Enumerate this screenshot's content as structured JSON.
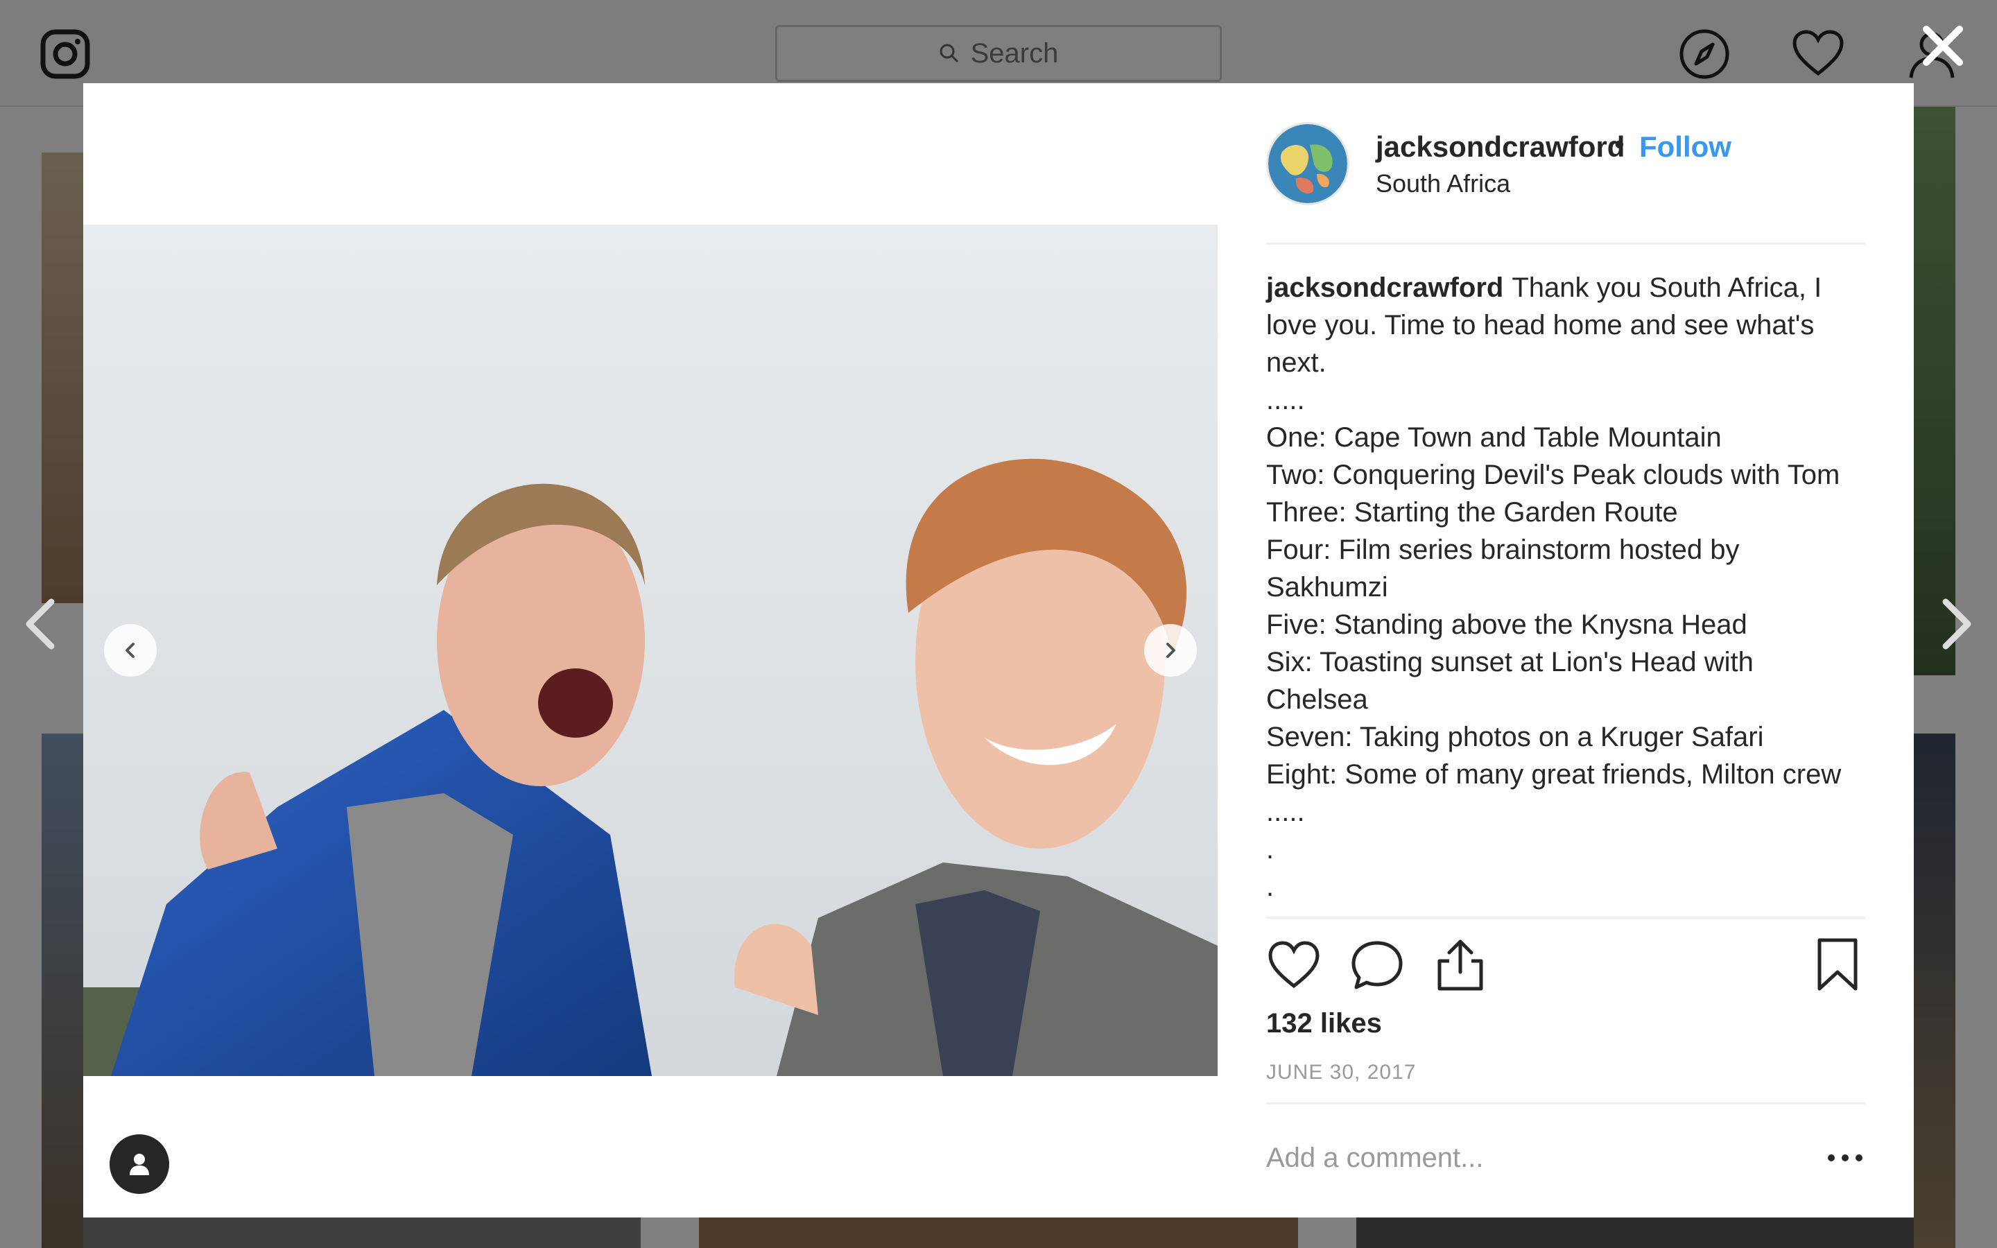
{
  "topbar": {
    "search_placeholder": "Search",
    "icons": [
      "instagram-logo-icon",
      "compass-icon",
      "heart-icon",
      "user-icon",
      "close-icon"
    ]
  },
  "post": {
    "username": "jacksondcrawford",
    "separator": "•",
    "follow_label": "Follow",
    "location": "South Africa",
    "caption_user": "jacksondcrawford",
    "caption_lines": [
      "Thank you South Africa, I",
      "love you. Time to head home and see what's",
      "next.",
      ".....",
      "One: Cape Town and Table Mountain",
      "Two: Conquering Devil's Peak clouds with Tom",
      "Three: Starting the Garden Route",
      "Four: Film series brainstorm hosted by",
      "Sakhumzi",
      "Five: Standing above the Knysna Head",
      "Six: Toasting sunset at Lion's Head with",
      "Chelsea",
      "Seven: Taking photos on a Kruger Safari",
      "Eight: Some of many great friends, Milton crew",
      ".....",
      ".",
      "."
    ],
    "likes": "132 likes",
    "date": "JUNE 30, 2017",
    "comment_placeholder": "Add a comment...",
    "colors": {
      "link": "#3897f0",
      "text": "#262626",
      "muted": "#999999"
    }
  }
}
